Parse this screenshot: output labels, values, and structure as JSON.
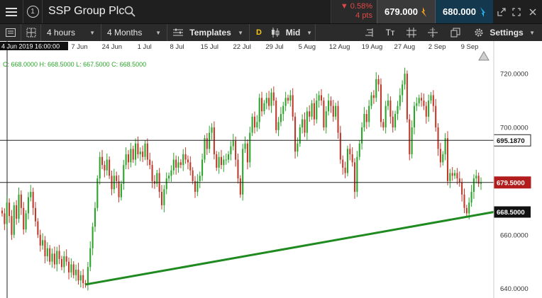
{
  "header": {
    "info_label": "1",
    "instrument": "SSP Group Plc",
    "change_pct": "0.58%",
    "change_pts": "4 pts",
    "sell_price": "679.000",
    "buy_price": "680.000"
  },
  "toolbar": {
    "interval": "4 hours",
    "range": "4 Months",
    "templates": "Templates",
    "d_badge": "D",
    "price_type": "Mid",
    "text_tool": "Tт",
    "settings": "Settings"
  },
  "chart_data": {
    "type": "candlestick",
    "instrument": "SSP Group Plc",
    "crosshair_time": "4 Jun 2019 16:00:00",
    "ohlc_label": {
      "o": "C: 668.0000",
      "h": "H: 668.5000",
      "l": "L: 667.5000",
      "c": "C: 668.5000"
    },
    "x_ticks": [
      "7 Jun",
      "24 Jun",
      "1 Jul",
      "8 Jul",
      "15 Jul",
      "22 Jul",
      "29 Jul",
      "5 Aug",
      "12 Aug",
      "19 Aug",
      "27 Aug",
      "2 Sep",
      "9 Sep"
    ],
    "y_ticks": [
      "720.0000",
      "700.0000",
      "660.0000",
      "640.0000"
    ],
    "y_range": [
      637,
      729
    ],
    "hlines": [
      {
        "value": 695.187,
        "label": "695.1870",
        "style": "black"
      },
      {
        "value": 679.5,
        "label": "679.5000",
        "style": "red"
      }
    ],
    "current_label": "668.5000",
    "trendline": {
      "from_index": 35,
      "from_value": 641.5,
      "to_value": 668.5,
      "color": "#1f8a1f"
    },
    "up_color": "#2aa52a",
    "down_color": "#c0392b",
    "closes": [
      668,
      664,
      672,
      667,
      660,
      671,
      666,
      675,
      670,
      662,
      668,
      674,
      676,
      670,
      665,
      660,
      656,
      658,
      652,
      655,
      650,
      653,
      649,
      654,
      651,
      648,
      652,
      650,
      646,
      649,
      645,
      647,
      643,
      645,
      642,
      641.5,
      648,
      655,
      663,
      670,
      681,
      689,
      686,
      684,
      688,
      682,
      677,
      682,
      680,
      674,
      679,
      686,
      690,
      687,
      692,
      688,
      694,
      690,
      691,
      689,
      694,
      688,
      686,
      680,
      679,
      683,
      676,
      671,
      677,
      681,
      682,
      684,
      688,
      685,
      687,
      686,
      690,
      688,
      687,
      684,
      680,
      676,
      680,
      682,
      688,
      696,
      692,
      698,
      700,
      690,
      685,
      689,
      686,
      688,
      688,
      690,
      693,
      695,
      688,
      681,
      675,
      692,
      694,
      687,
      698,
      704,
      700,
      702,
      711,
      706,
      709,
      711,
      708,
      713,
      710,
      699,
      702,
      705,
      708,
      711,
      710,
      712,
      704,
      691,
      694,
      700,
      703,
      698,
      706,
      704,
      709,
      703,
      710,
      712,
      710,
      700,
      706,
      710,
      708,
      704,
      708,
      698,
      688,
      685,
      683,
      692,
      690,
      687,
      676,
      689,
      694,
      700,
      705,
      702,
      708,
      712,
      711,
      718,
      716,
      702,
      700,
      708,
      710,
      704,
      700,
      705,
      708,
      712,
      716,
      720,
      703,
      690,
      700,
      708,
      709,
      711,
      710,
      708,
      704,
      710,
      712,
      708,
      700,
      692,
      687,
      690,
      696,
      680,
      683,
      682,
      683,
      681,
      679.5,
      675,
      670,
      668,
      672,
      676,
      681,
      682,
      679,
      679.5
    ]
  }
}
